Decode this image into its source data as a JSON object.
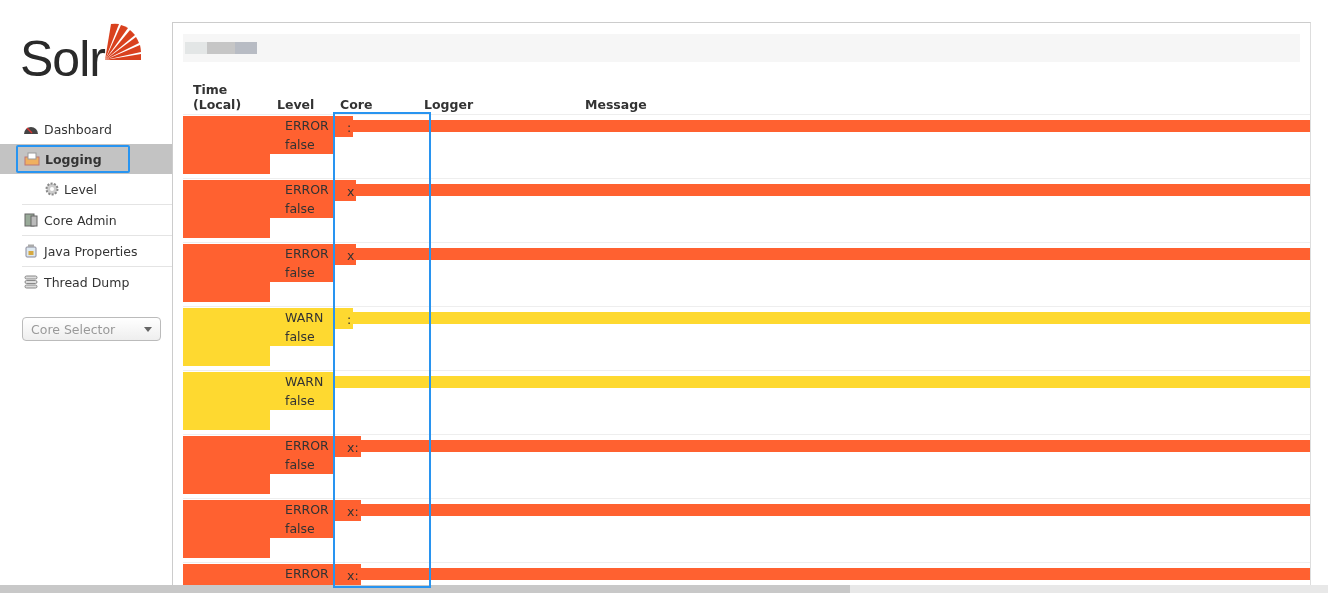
{
  "logo": {
    "text": "Solr"
  },
  "nav": [
    {
      "label": "Dashboard",
      "selected": false,
      "annotated": false
    },
    {
      "label": "Logging",
      "selected": true,
      "annotated": true,
      "children": [
        {
          "label": "Level",
          "selected": false
        }
      ]
    },
    {
      "label": "Core Admin",
      "selected": false,
      "annotated": false
    },
    {
      "label": "Java Properties",
      "selected": false,
      "annotated": false
    },
    {
      "label": "Thread Dump",
      "selected": false,
      "annotated": false
    }
  ],
  "core_selector": {
    "placeholder": "Core Selector"
  },
  "table": {
    "columns": [
      {
        "label": "Time (Local)",
        "annotated": false
      },
      {
        "label": "Level",
        "annotated": false
      },
      {
        "label": "Core",
        "annotated": true
      },
      {
        "label": "Logger",
        "annotated": false
      },
      {
        "label": "Message",
        "annotated": false
      }
    ],
    "rows": [
      {
        "level": "ERROR",
        "flag": "false",
        "core": ":",
        "color": "#ff6130"
      },
      {
        "level": "ERROR",
        "flag": "false",
        "core": "x",
        "color": "#ff6130"
      },
      {
        "level": "ERROR",
        "flag": "false",
        "core": "x",
        "color": "#ff6130"
      },
      {
        "level": "WARN",
        "flag": "false",
        "core": ":",
        "color": "#fed930"
      },
      {
        "level": "WARN",
        "flag": "false",
        "color": "#fed930"
      },
      {
        "level": "ERROR",
        "flag": "false",
        "core": "x:",
        "color": "#ff6130"
      },
      {
        "level": "ERROR",
        "flag": "false",
        "core": "x:",
        "color": "#ff6130"
      },
      {
        "level": "ERROR",
        "core": "x:",
        "color": "#ff6130"
      }
    ]
  }
}
